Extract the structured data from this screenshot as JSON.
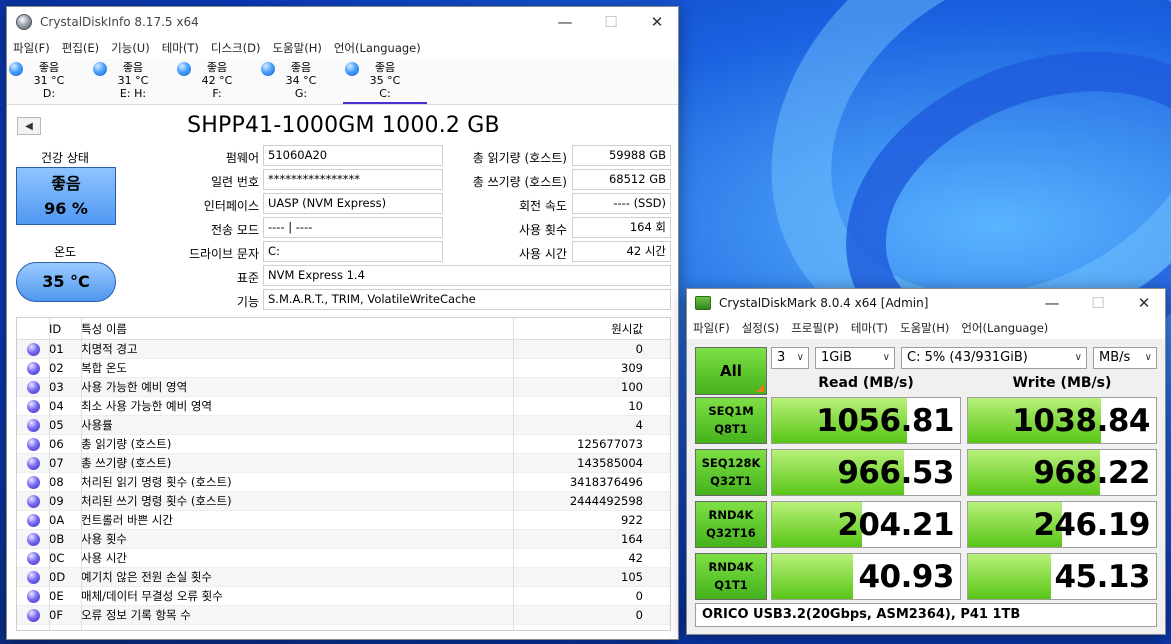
{
  "cdi": {
    "title": "CrystalDiskInfo 8.17.5 x64",
    "menu": [
      "파일(F)",
      "편집(E)",
      "기능(U)",
      "테마(T)",
      "디스크(D)",
      "도움말(H)",
      "언어(Language)"
    ],
    "drives": [
      {
        "status": "좋음",
        "temp": "31 °C",
        "letter": "D:"
      },
      {
        "status": "좋음",
        "temp": "31 °C",
        "letter": "E: H:"
      },
      {
        "status": "좋음",
        "temp": "42 °C",
        "letter": "F:"
      },
      {
        "status": "좋음",
        "temp": "34 °C",
        "letter": "G:"
      },
      {
        "status": "좋음",
        "temp": "35 °C",
        "letter": "C:"
      }
    ],
    "model": "SHPP41-1000GM 1000.2 GB",
    "health_label": "건강 상태",
    "health_status": "좋음",
    "health_percent": "96 %",
    "temp_label": "온도",
    "temp_value": "35 °C",
    "labels": {
      "firmware": "펌웨어",
      "serial": "일련 번호",
      "interface": "인터페이스",
      "transfer": "전송 모드",
      "drive_letter": "드라이브 문자",
      "standard": "표준",
      "features": "기능",
      "host_reads": "총 읽기량 (호스트)",
      "host_writes": "총 쓰기량 (호스트)",
      "rotation": "회전 속도",
      "power_count": "사용 횟수",
      "power_hours": "사용 시간"
    },
    "values": {
      "firmware": "51060A20",
      "serial": "****************",
      "interface": "UASP (NVM Express)",
      "transfer": "---- | ----",
      "drive_letter": "C:",
      "standard": "NVM Express 1.4",
      "features": "S.M.A.R.T., TRIM, VolatileWriteCache",
      "host_reads": "59988 GB",
      "host_writes": "68512 GB",
      "rotation": "---- (SSD)",
      "power_count": "164 회",
      "power_hours": "42 시간"
    },
    "smart_headers": {
      "id": "ID",
      "name": "특성 이름",
      "raw": "원시값"
    },
    "smart": [
      {
        "id": "01",
        "name": "치명적 경고",
        "raw": "0"
      },
      {
        "id": "02",
        "name": "복합 온도",
        "raw": "309"
      },
      {
        "id": "03",
        "name": "사용 가능한 예비 영역",
        "raw": "100"
      },
      {
        "id": "04",
        "name": "최소 사용 가능한 예비 영역",
        "raw": "10"
      },
      {
        "id": "05",
        "name": "사용률",
        "raw": "4"
      },
      {
        "id": "06",
        "name": "총 읽기량 (호스트)",
        "raw": "125677073"
      },
      {
        "id": "07",
        "name": "총 쓰기량 (호스트)",
        "raw": "143585004"
      },
      {
        "id": "08",
        "name": "처리된 읽기 명령 횟수 (호스트)",
        "raw": "3418376496"
      },
      {
        "id": "09",
        "name": "처리된 쓰기 명령 횟수 (호스트)",
        "raw": "2444492598"
      },
      {
        "id": "0A",
        "name": "컨트롤러 바쁜 시간",
        "raw": "922"
      },
      {
        "id": "0B",
        "name": "사용 횟수",
        "raw": "164"
      },
      {
        "id": "0C",
        "name": "사용 시간",
        "raw": "42"
      },
      {
        "id": "0D",
        "name": "예기치 않은 전원 손실 횟수",
        "raw": "105"
      },
      {
        "id": "0E",
        "name": "매체/데이터 무결성 오류 횟수",
        "raw": "0"
      },
      {
        "id": "0F",
        "name": "오류 정보 기록 항목 수",
        "raw": "0"
      }
    ]
  },
  "cdm": {
    "title": "CrystalDiskMark 8.0.4 x64 [Admin]",
    "menu": [
      "파일(F)",
      "설정(S)",
      "프로필(P)",
      "테마(T)",
      "도움말(H)",
      "언어(Language)"
    ],
    "all_label": "All",
    "count": "3",
    "size": "1GiB",
    "drive": "C: 5% (43/931GiB)",
    "unit": "MB/s",
    "read_header": "Read (MB/s)",
    "write_header": "Write (MB/s)",
    "tests": [
      {
        "line1": "SEQ1M",
        "line2": "Q8T1",
        "read": "1056.81",
        "write": "1038.84",
        "read_fill": 0.72,
        "write_fill": 0.71
      },
      {
        "line1": "SEQ128K",
        "line2": "Q32T1",
        "read": "966.53",
        "write": "968.22",
        "read_fill": 0.7,
        "write_fill": 0.7
      },
      {
        "line1": "RND4K",
        "line2": "Q32T16",
        "read": "204.21",
        "write": "246.19",
        "read_fill": 0.48,
        "write_fill": 0.5
      },
      {
        "line1": "RND4K",
        "line2": "Q1T1",
        "read": "40.93",
        "write": "45.13",
        "read_fill": 0.43,
        "write_fill": 0.44
      }
    ],
    "comment": "ORICO USB3.2(20Gbps, ASM2364), P41 1TB"
  }
}
